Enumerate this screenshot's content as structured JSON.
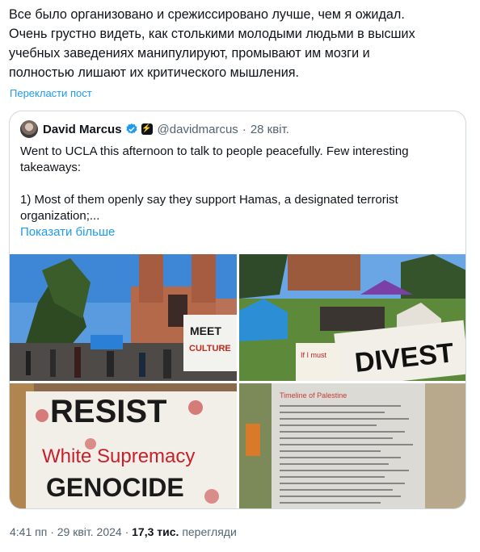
{
  "post": {
    "text": "Все было организовано и срежиссировано лучше, чем я ожидал.\nОчень грустно видеть, как столькими молодыми людьми в высших\nучебных заведениях манипулируют, промывают им мозги и\nполностью лишают их критического мышления.",
    "translate_label": "Перекласти пост"
  },
  "quote": {
    "author_name": "David Marcus",
    "affiliate_badge": "⚡",
    "handle": "@davidmarcus",
    "separator": "·",
    "date": "28 квіт.",
    "text": "Went to UCLA this afternoon to talk to people peacefully. Few interesting\ntakeaways:\n\n1) Most of them openly say they support Hamas, a designated terrorist\norganization;...",
    "show_more_label": "Показати більше",
    "images": [
      {
        "signs": [
          "MEET",
          "CULTURE"
        ]
      },
      {
        "signs": [
          "DIVEST",
          "If I must"
        ]
      },
      {
        "signs": [
          "RESIST",
          "White Supremacy",
          "GENOCIDE"
        ]
      },
      {
        "signs": [
          "Timeline of Palestine"
        ]
      }
    ]
  },
  "meta": {
    "time": "4:41 пп",
    "dot1": "·",
    "date": "29 квіт. 2024",
    "dot2": "·",
    "views_count": "17,3 тис.",
    "views_label": "перегляди"
  },
  "colors": {
    "accent": "#1d9bf0",
    "text": "#0f1419",
    "secondary": "#536471",
    "border": "#cfd9de"
  },
  "icons": {
    "verified": "verified-badge-icon",
    "affiliate": "affiliate-badge-icon"
  }
}
